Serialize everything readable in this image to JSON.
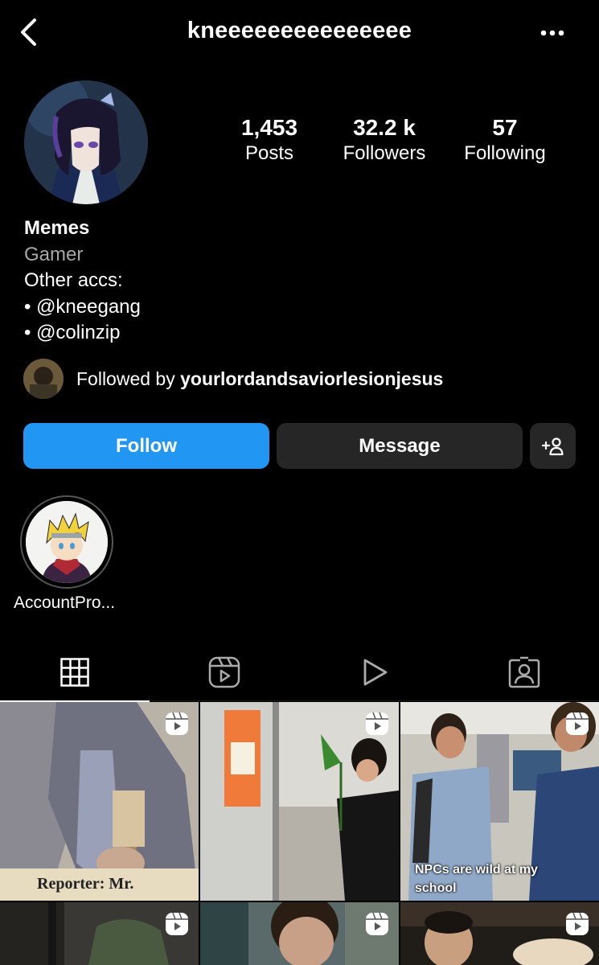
{
  "header": {
    "username": "kneeeeeeeeeeeeeee",
    "back_icon": "chevron-left-icon",
    "more_icon": "more-horizontal-icon"
  },
  "profile": {
    "stats": [
      {
        "value": "1,453",
        "label": "Posts"
      },
      {
        "value": "32.2 k",
        "label": "Followers"
      },
      {
        "value": "57",
        "label": "Following"
      }
    ],
    "bio": {
      "name": "Memes",
      "category": "Gamer",
      "line1": "Other accs:",
      "line2": "• @kneegang",
      "line3": "• @colinzip"
    },
    "followed_by": {
      "prefix": "Followed by ",
      "user": "yourlordandsaviorlesionjesus"
    }
  },
  "actions": {
    "follow_label": "Follow",
    "message_label": "Message",
    "add_icon": "add-person-icon"
  },
  "highlights": [
    {
      "label": "AccountPro..."
    }
  ],
  "tabs": [
    {
      "name": "grid",
      "icon": "grid-icon",
      "active": true
    },
    {
      "name": "reels",
      "icon": "reels-icon",
      "active": false
    },
    {
      "name": "videos",
      "icon": "play-icon",
      "active": false
    },
    {
      "name": "tagged",
      "icon": "tagged-person-icon",
      "active": false
    }
  ],
  "posts": [
    {
      "caption": "Reporter: Mr.",
      "reel": true
    },
    {
      "caption": "",
      "reel": true
    },
    {
      "caption": "NPCs are wild at my school",
      "reel": true
    },
    {
      "caption": "",
      "reel": true
    },
    {
      "caption": "",
      "reel": true
    },
    {
      "caption": "",
      "reel": true
    }
  ],
  "colors": {
    "background": "#000000",
    "follow_button": "#2196f3",
    "secondary_button": "#262626",
    "muted_text": "#a8a8a8"
  }
}
